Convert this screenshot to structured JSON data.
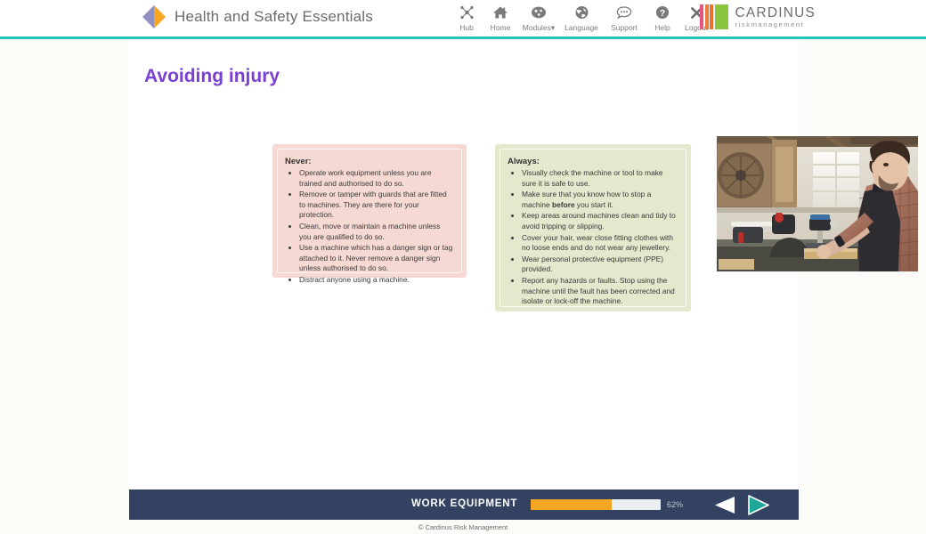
{
  "header": {
    "logo_icon": "diamond-logo-icon",
    "title": "Health and Safety Essentials",
    "nav": [
      {
        "id": "hub",
        "label": "Hub",
        "icon": "network-hub-icon"
      },
      {
        "id": "home",
        "label": "Home",
        "icon": "home-icon"
      },
      {
        "id": "modules",
        "label": "Modules",
        "icon": "modules-wheel-icon",
        "caret": "▾"
      },
      {
        "id": "language",
        "label": "Language",
        "icon": "globe-icon"
      },
      {
        "id": "support",
        "label": "Support",
        "icon": "speech-bubble-icon"
      },
      {
        "id": "help",
        "label": "Help",
        "icon": "question-circle-icon"
      },
      {
        "id": "logout",
        "label": "Logout",
        "icon": "close-x-icon"
      }
    ],
    "company": {
      "name": "CARDINUS",
      "tagline": "riskmanagement",
      "bar_colors": [
        "#e8547c",
        "#f07c3c",
        "#f46b2a",
        "#8cc63f"
      ]
    },
    "accent_color": "#23c4b5"
  },
  "slide": {
    "title": "Avoiding injury",
    "title_color": "#7a3fd4",
    "cards": [
      {
        "id": "never",
        "heading": "Never:",
        "bg_color": "#f6d9d3",
        "items": [
          "Operate work equipment unless you are trained and authorised to do so.",
          "Remove or tamper with guards that are fitted to machines. They are there for your protection.",
          "Clean, move or maintain a machine unless you are qualified to do so.",
          "Use a machine which has a danger sign or tag attached to it. Never remove a danger sign unless authorised to do so.",
          "Distract anyone using a machine."
        ]
      },
      {
        "id": "always",
        "heading": "Always:",
        "bg_color": "#e2e9cd",
        "items": [
          "Visually check the machine or tool to make sure it is safe to use.",
          "Make sure that you know how to stop a machine <b>before</b> you start it.",
          "Keep areas around machines clean and tidy to avoid tripping or slipping.",
          "Cover your hair, wear close fitting clothes with no loose ends and do not wear any jewellery.",
          "Wear personal protective equipment (PPE) provided.",
          "Report any hazards or faults. Stop using the machine until the fault has been corrected and isolate or lock-off the machine."
        ]
      }
    ],
    "photo_alt": "workshop-photo-man-using-saw-bench"
  },
  "bottom_bar": {
    "module_title": "WORK EQUIPMENT",
    "progress_percent": 62,
    "progress_label": "62%",
    "progress_fill_color": "#f5a623",
    "prev_icon": "previous-arrow-icon",
    "next_icon": "next-arrow-icon",
    "bg_color": "#344261"
  },
  "footer": {
    "copyright_mark": "©",
    "copyright_text": "Cardinus Risk Management"
  }
}
